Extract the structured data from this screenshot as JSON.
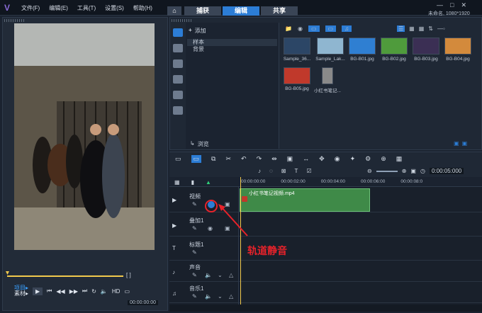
{
  "menu": [
    "文件(F)",
    "编辑(E)",
    "工具(T)",
    "设置(S)",
    "帮助(H)"
  ],
  "tabs": [
    {
      "label": "捕获"
    },
    {
      "label": "编辑"
    },
    {
      "label": "共享"
    }
  ],
  "window_caption": "未命名, 1080*1920",
  "preview": {
    "project_label": "项目▸",
    "clip_label": "素材▸",
    "hd_label": "HD",
    "timecode": "00:00:00:00"
  },
  "library": {
    "add_label": "添加",
    "folders": [
      "样本",
      "背景"
    ],
    "browse_label": "浏览",
    "thumbs": [
      {
        "label": "Sample_36...",
        "color": "#2c4666"
      },
      {
        "label": "Sample_Lak...",
        "color": "#8fb6d0"
      },
      {
        "label": "BG-B01.jpg",
        "color": "#2f7fd2"
      },
      {
        "label": "BG-B02.jpg",
        "color": "#4f9b3c"
      },
      {
        "label": "BG-B03.jpg",
        "color": "#3b2f54"
      },
      {
        "label": "BG-B04.jpg",
        "color": "#d38a3c"
      },
      {
        "label": "BG-B05.jpg",
        "color": "#c0392b"
      },
      {
        "label": "小红书笔记...",
        "color": "#8a8a8a"
      }
    ]
  },
  "timeline": {
    "zoom_timecode": "0:00:05:000",
    "ruler": [
      "00:00:00:00",
      "00:00:02:00",
      "00:00:04:00",
      "00:00:06:00",
      "00:00:08:0"
    ],
    "tracks": [
      {
        "label": "视频"
      },
      {
        "label": "叠加1"
      },
      {
        "label": "标题1"
      },
      {
        "label": "声音"
      },
      {
        "label": "音乐1"
      }
    ],
    "clip_label": "小红书笔记视频.mp4"
  },
  "annotation": "轨道静音"
}
